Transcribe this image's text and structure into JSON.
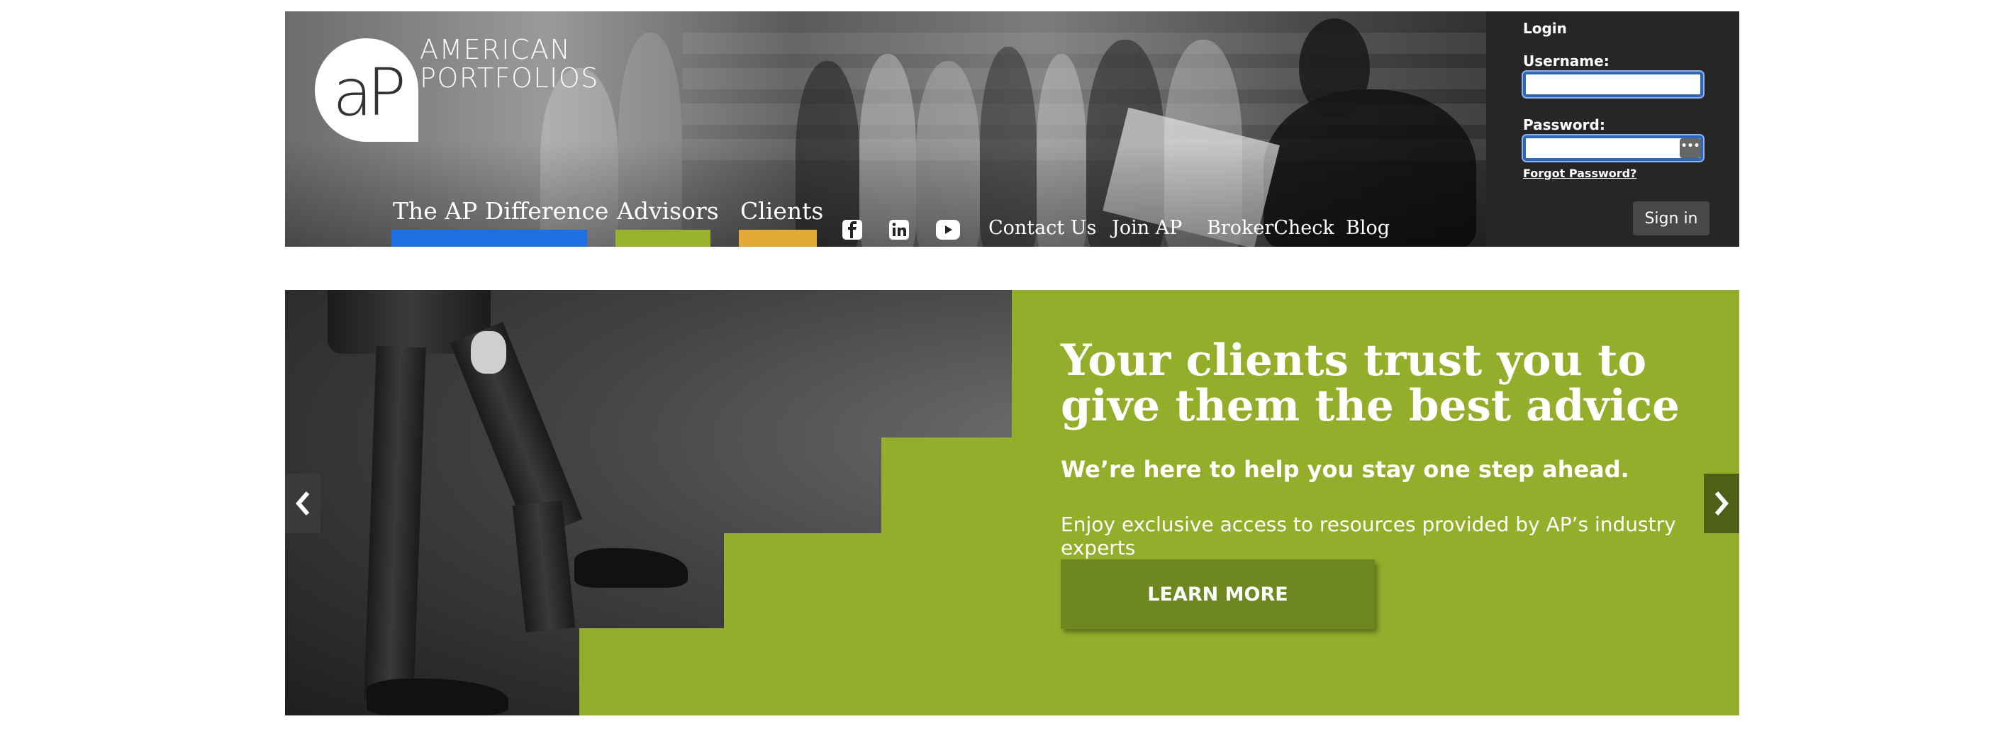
{
  "header": {
    "logo": {
      "monogram": "aP",
      "line1": "AMERICAN",
      "line2": "PORTFOLIOS"
    },
    "nav": {
      "main": [
        {
          "label": "The AP Difference",
          "color": "#1f6fe4"
        },
        {
          "label": "Advisors",
          "color": "#98b22d"
        },
        {
          "label": "Clients",
          "color": "#e3a937"
        }
      ],
      "social_icons": [
        "facebook-icon",
        "linkedin-icon",
        "youtube-icon"
      ],
      "links": [
        "Contact Us",
        "Join AP",
        "BrokerCheck",
        "Blog"
      ]
    },
    "login": {
      "title": "Login",
      "username_label": "Username:",
      "username_value": "",
      "password_label": "Password:",
      "password_value": "",
      "forgot": "Forgot Password?",
      "signin": "Sign in"
    }
  },
  "hero": {
    "headline": "Your clients trust you to give them the best advice",
    "subheadline": "We’re here to help you stay one step ahead.",
    "body": "Enjoy exclusive access to resources provided by AP’s industry experts",
    "cta": "LEARN MORE",
    "accent_color": "#94ad2b",
    "button_color": "#6f8721",
    "prev_icon": "chevron-left-icon",
    "next_icon": "chevron-right-icon"
  }
}
